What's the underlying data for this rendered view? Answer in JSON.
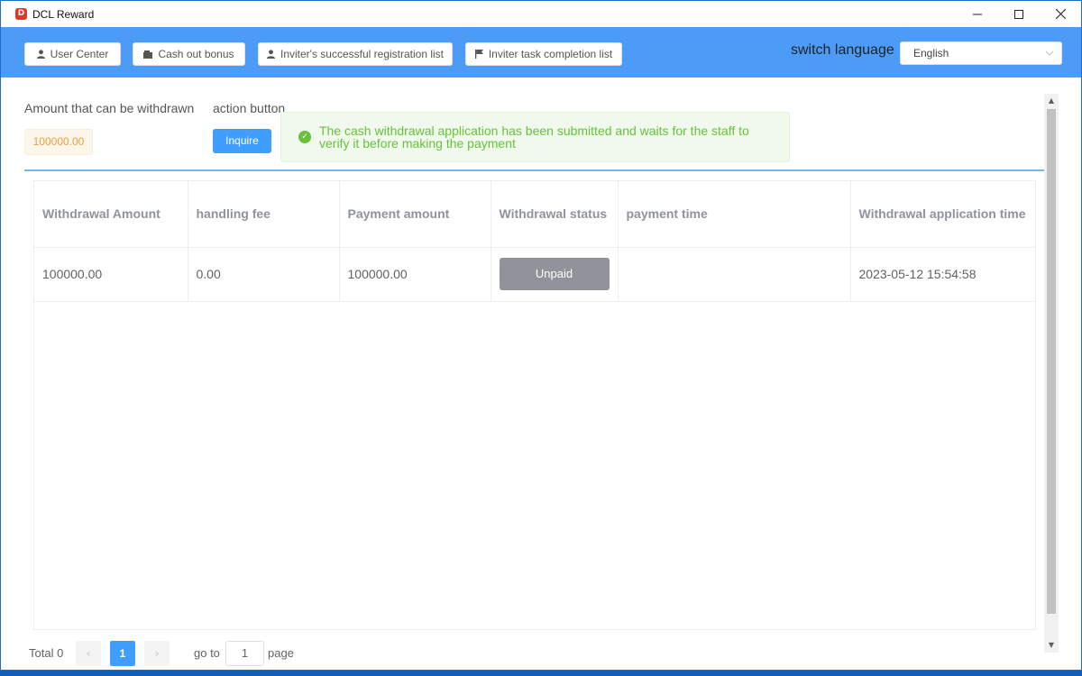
{
  "window": {
    "title": "DCL Reward",
    "app_icon_glyph": "D",
    "controls": [
      "minimize-icon",
      "maximize-icon",
      "close-icon"
    ]
  },
  "toolbar": {
    "buttons": [
      {
        "label": "User Center",
        "icon": "user-icon"
      },
      {
        "label": "Cash out bonus",
        "icon": "wallet-icon"
      },
      {
        "label": "Inviter's successful registration list",
        "icon": "user-icon"
      },
      {
        "label": "Inviter task completion list",
        "icon": "flag-icon"
      }
    ],
    "language_label": "switch language",
    "language_value": "English",
    "background_color": "#4c9cf7"
  },
  "main": {
    "amount_label": "Amount that can be withdrawn",
    "action_label": "action button",
    "amount_value": "100000.00",
    "inquire_label": "Inquire",
    "toast_message": "The cash withdrawal application has been submitted and waits for the staff to verify it before making the payment",
    "toast_color": "#67c23a"
  },
  "table": {
    "columns": [
      "Withdrawal Amount",
      "handling fee",
      "Payment amount",
      "Withdrawal status",
      "payment time",
      "Withdrawal application time"
    ],
    "rows": [
      {
        "withdrawal_amount": "100000.00",
        "handling_fee": "0.00",
        "payment_amount": "100000.00",
        "status": "Unpaid",
        "payment_time": "",
        "application_time": "2023-05-12 15:54:58"
      }
    ]
  },
  "pagination": {
    "total": "Total 0",
    "current_page": "1",
    "goto_label": "go to",
    "goto_value": "1",
    "page_label": "page"
  }
}
